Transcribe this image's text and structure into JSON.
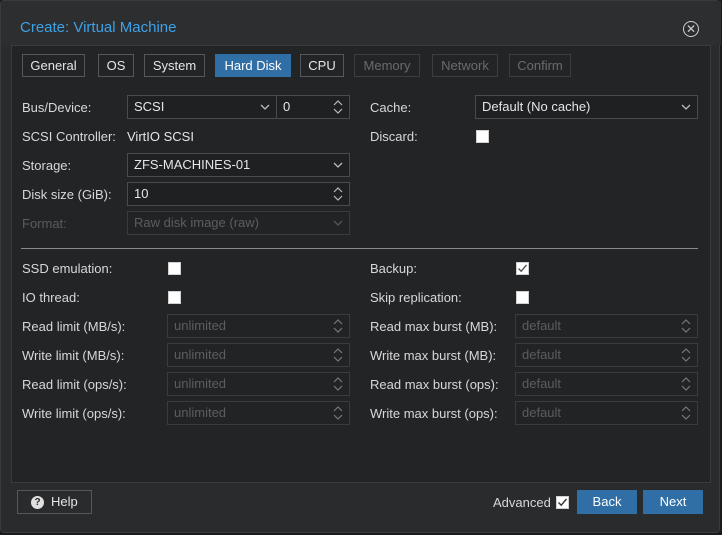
{
  "window": {
    "title": "Create: Virtual Machine"
  },
  "tabs": [
    {
      "label": "General",
      "state": "normal"
    },
    {
      "label": "OS",
      "state": "normal"
    },
    {
      "label": "System",
      "state": "normal"
    },
    {
      "label": "Hard Disk",
      "state": "active"
    },
    {
      "label": "CPU",
      "state": "normal"
    },
    {
      "label": "Memory",
      "state": "disabled"
    },
    {
      "label": "Network",
      "state": "disabled"
    },
    {
      "label": "Confirm",
      "state": "disabled"
    }
  ],
  "left": {
    "bus_label": "Bus/Device:",
    "bus_value": "SCSI",
    "device_value": "0",
    "controller_label": "SCSI Controller:",
    "controller_value": "VirtIO SCSI",
    "storage_label": "Storage:",
    "storage_value": "ZFS-MACHINES-01",
    "disk_size_label": "Disk size (GiB):",
    "disk_size_value": "10",
    "format_label": "Format:",
    "format_value": "Raw disk image (raw)"
  },
  "right": {
    "cache_label": "Cache:",
    "cache_value": "Default (No cache)",
    "discard_label": "Discard:",
    "discard_checked": false
  },
  "advanced": {
    "ssd_label": "SSD emulation:",
    "ssd_checked": false,
    "iothread_label": "IO thread:",
    "iothread_checked": false,
    "read_limit_label": "Read limit (MB/s):",
    "write_limit_label": "Write limit (MB/s):",
    "read_ops_label": "Read limit (ops/s):",
    "write_ops_label": "Write limit (ops/s):",
    "limit_placeholder": "unlimited",
    "backup_label": "Backup:",
    "backup_checked": true,
    "skip_repl_label": "Skip replication:",
    "skip_repl_checked": false,
    "read_burst_label": "Read max burst (MB):",
    "write_burst_label": "Write max burst (MB):",
    "read_burst_ops_label": "Read max burst (ops):",
    "write_burst_ops_label": "Write max burst (ops):",
    "burst_placeholder": "default"
  },
  "footer": {
    "help_label": "Help",
    "advanced_label": "Advanced",
    "advanced_checked": true,
    "back_label": "Back",
    "next_label": "Next"
  },
  "colors": {
    "accent": "#3fa1e6",
    "button": "#2f6fa6"
  }
}
